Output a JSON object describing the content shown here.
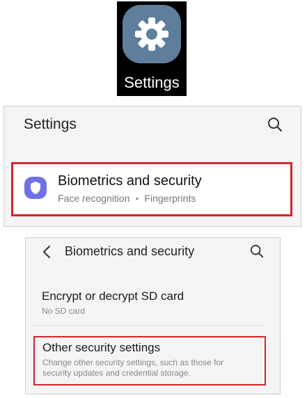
{
  "app_tile": {
    "label": "Settings",
    "icon": "gear-icon",
    "icon_bg_color": "#5f7e9c"
  },
  "settings_screen": {
    "title": "Settings",
    "search_icon": "search-icon",
    "highlight_color": "#d7232c",
    "item": {
      "icon": "shield-icon",
      "icon_bg_color": "#6f72e6",
      "title": "Biometrics and security",
      "subtitle_parts": [
        "Face recognition",
        "Fingerprints"
      ],
      "separator": "•"
    }
  },
  "biometrics_screen": {
    "back_icon": "chevron-left-icon",
    "title": "Biometrics and security",
    "search_icon": "search-icon",
    "items": [
      {
        "title": "Encrypt or decrypt SD card",
        "subtitle": "No SD card"
      },
      {
        "title": "Other security settings",
        "subtitle": "Change other security settings, such as those for security updates and credential storage."
      }
    ]
  }
}
